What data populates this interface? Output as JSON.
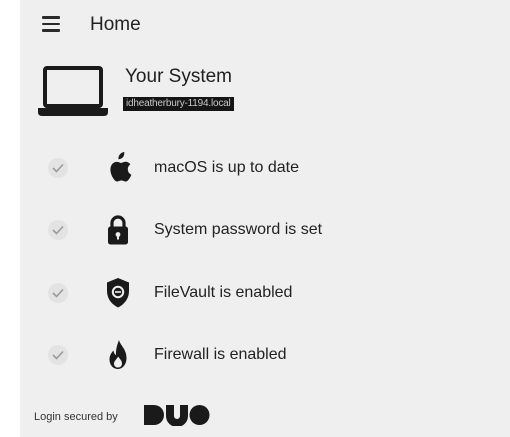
{
  "header": {
    "title": "Home",
    "menu_icon": "hamburger-menu-icon"
  },
  "system": {
    "icon": "laptop-icon",
    "title": "Your System",
    "hostname": "idheatherbury-1194.local"
  },
  "checks": [
    {
      "icon": "apple-icon",
      "label": "macOS is up to date",
      "status": "passed"
    },
    {
      "icon": "lock-icon",
      "label": "System password is set",
      "status": "passed"
    },
    {
      "icon": "filevault-shield-icon",
      "label": "FileVault is enabled",
      "status": "passed"
    },
    {
      "icon": "flame-icon",
      "label": "Firewall is enabled",
      "status": "passed"
    }
  ],
  "footer": {
    "text": "Login secured by",
    "logo": "DUO"
  },
  "colors": {
    "panel_bg": "#efefef",
    "text": "#222222",
    "check_bg": "#e3e3e3",
    "icon": "#1a1a1a"
  }
}
